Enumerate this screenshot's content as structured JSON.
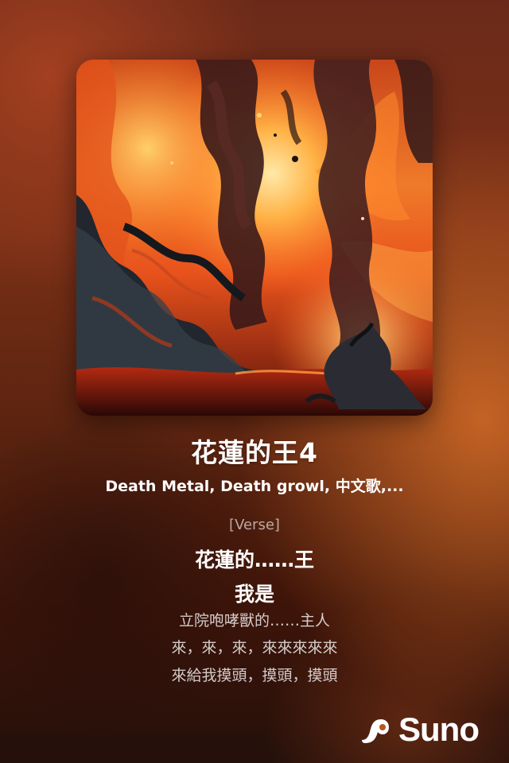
{
  "track": {
    "title": "花蓮的王4",
    "styles": "Death Metal, Death growl, 中文歌,..."
  },
  "lyrics": {
    "section_tag": "[Verse]",
    "lines": [
      "花蓮的……王",
      "我是",
      "立院咆哮獸的……主人",
      "來，來，來，來來來來來",
      "來給我摸頭，摸頭，摸頭"
    ]
  },
  "brand": {
    "name": "Suno",
    "icon": "suno-logo-icon"
  },
  "colors": {
    "background_top": "#6b2a19",
    "background_bottom": "#24100b",
    "accent_orange": "#d66e28",
    "text": "#ffffff"
  }
}
